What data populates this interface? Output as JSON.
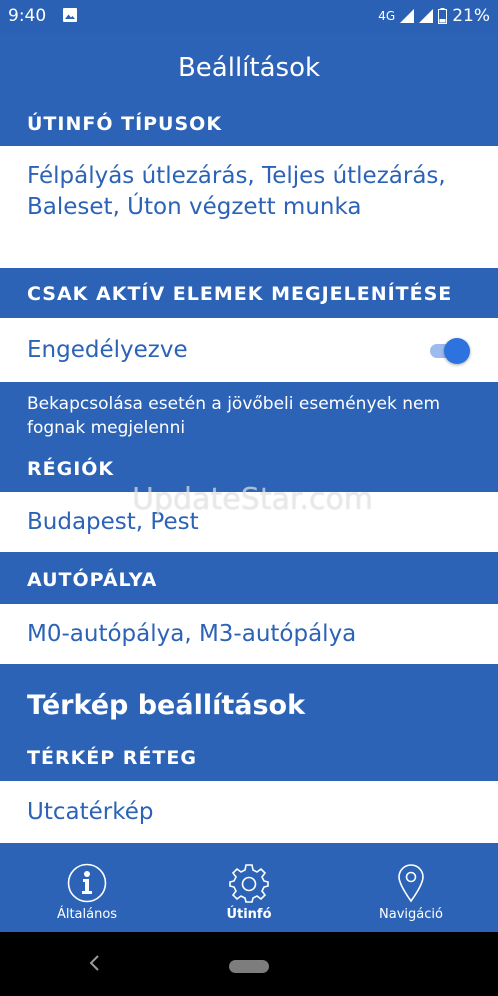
{
  "status_bar": {
    "time": "9:40",
    "network": "4G",
    "battery": "21%"
  },
  "header": {
    "title": "Beállítások"
  },
  "sections": {
    "travel_types": {
      "title": "ÚTINFÓ TÍPUSOK",
      "value": "Félpályás útlezárás, Teljes útlezárás, Baleset, Úton végzett munka"
    },
    "active_only": {
      "title": "CSAK AKTÍV ELEMEK MEGJELENÍTÉSE",
      "label": "Engedélyezve",
      "toggle_on": true,
      "note": "Bekapcsolása esetén a jövőbeli események nem fognak megjelenni"
    },
    "regions": {
      "title": "RÉGIÓK",
      "value": "Budapest, Pest"
    },
    "motorway": {
      "title": "AUTÓPÁLYA",
      "value": "M0-autópálya, M3-autópálya"
    },
    "map_settings": {
      "title": "Térkép beállítások"
    },
    "map_layer": {
      "title": "TÉRKÉP RÉTEG",
      "value": "Utcatérkép"
    }
  },
  "watermark": "UpdateStar.com",
  "bottom_nav": {
    "items": [
      {
        "label": "Általános",
        "icon": "info-icon",
        "active": false
      },
      {
        "label": "Útinfó",
        "icon": "gear-icon",
        "active": true
      },
      {
        "label": "Navigáció",
        "icon": "location-pin-icon",
        "active": false
      }
    ]
  },
  "colors": {
    "primary": "#2c63b7",
    "toggle_thumb": "#2d73e0",
    "row_background": "#ffffff"
  }
}
